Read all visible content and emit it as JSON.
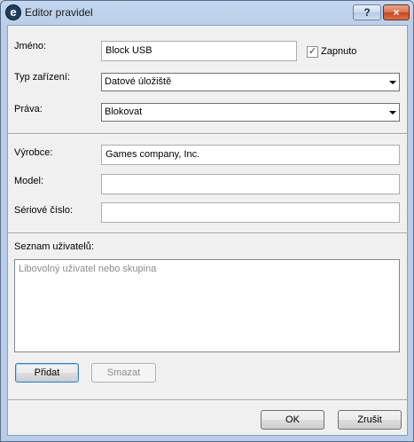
{
  "window": {
    "title": "Editor pravidel",
    "help_label": "?",
    "close_label": "×"
  },
  "form": {
    "name_label": "Jméno:",
    "name_value": "Block USB",
    "enabled_label": "Zapnuto",
    "enabled_checked": true,
    "device_type_label": "Typ zařízení:",
    "device_type_value": "Datové úložiště",
    "rights_label": "Práva:",
    "rights_value": "Blokovat",
    "vendor_label": "Výrobce:",
    "vendor_value": "Games company, Inc.",
    "model_label": "Model:",
    "model_value": "",
    "serial_label": "Sériové číslo:",
    "serial_value": ""
  },
  "users": {
    "label": "Seznam uživatelů:",
    "placeholder": "Libovolný uživatel nebo skupina",
    "add_label": "Přidat",
    "remove_label": "Smazat"
  },
  "footer": {
    "ok_label": "OK",
    "cancel_label": "Zrušit"
  }
}
